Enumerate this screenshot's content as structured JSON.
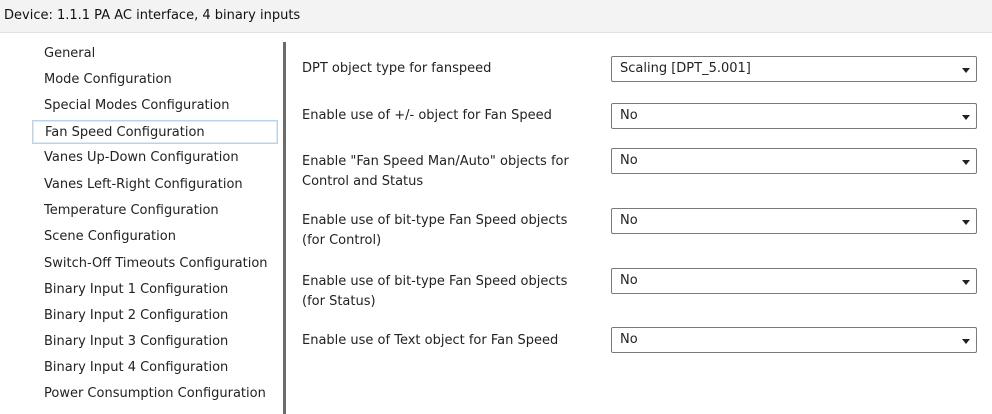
{
  "header": {
    "title": "Device: 1.1.1  PA AC interface, 4 binary inputs"
  },
  "sidebar": {
    "selected_index": 3,
    "items": [
      {
        "label": "General"
      },
      {
        "label": "Mode Configuration"
      },
      {
        "label": "Special Modes Configuration"
      },
      {
        "label": "Fan Speed Configuration"
      },
      {
        "label": "Vanes Up-Down Configuration"
      },
      {
        "label": "Vanes Left-Right Configuration"
      },
      {
        "label": "Temperature Configuration"
      },
      {
        "label": "Scene Configuration"
      },
      {
        "label": "Switch-Off Timeouts Configuration"
      },
      {
        "label": "Binary Input 1 Configuration"
      },
      {
        "label": "Binary Input 2 Configuration"
      },
      {
        "label": "Binary Input 3 Configuration"
      },
      {
        "label": "Binary Input 4 Configuration"
      },
      {
        "label": "Power Consumption Configuration"
      }
    ]
  },
  "params": [
    {
      "label": "DPT object type for fanspeed",
      "value": "Scaling [DPT_5.001]"
    },
    {
      "label": "Enable use of +/- object for Fan Speed",
      "value": "No"
    },
    {
      "label": "Enable \"Fan Speed Man/Auto\" objects for Control and Status",
      "value": "No"
    },
    {
      "label": "Enable use of bit-type Fan Speed objects (for Control)",
      "value": "No"
    },
    {
      "label": "Enable use of bit-type Fan Speed objects (for Status)",
      "value": "No"
    },
    {
      "label": "Enable use of Text object for Fan Speed",
      "value": "No"
    }
  ]
}
